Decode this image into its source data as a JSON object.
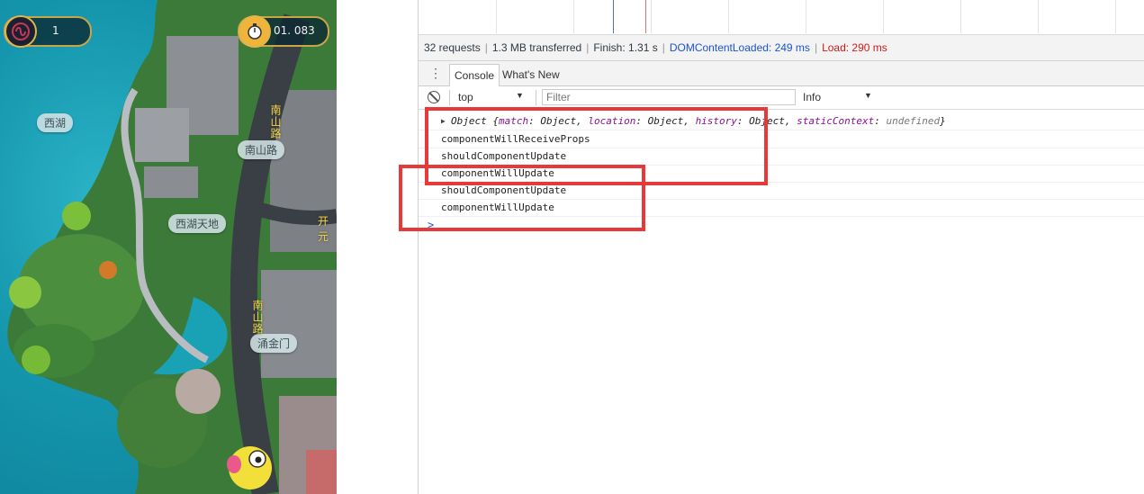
{
  "game": {
    "score": "1",
    "timer": "01. 083",
    "labels": {
      "xihu": "西湖",
      "nanshanlu": "南山路",
      "xihutiandi": "西湖天地",
      "yongjinmen": "涌金门"
    },
    "road_labels": {
      "road_top": "南山路",
      "road_bottom": "南山路",
      "road_right": "开元"
    },
    "colors": {
      "water": "#1596ad",
      "hud_border": "#c9a548",
      "road_text": "#f4d64a"
    }
  },
  "devtools": {
    "summary": {
      "requests": "32 requests",
      "transferred": "1.3 MB transferred",
      "finish": "Finish: 1.31 s",
      "dcl": "DOMContentLoaded: 249 ms",
      "load": "Load: 290 ms"
    },
    "tabs": [
      "Console",
      "What's New"
    ],
    "toolbar": {
      "context": "top",
      "filter_placeholder": "Filter",
      "level": "Info"
    },
    "messages": {
      "object_line": {
        "prefix": "Object {",
        "k1": "match",
        "v1": ": Object, ",
        "k2": "location",
        "v2": ": Object, ",
        "k3": "history",
        "v3": ": Object, ",
        "k4": "staticContext",
        "v4": ": ",
        "v4_value": "undefined",
        "suffix": "}"
      },
      "lines": [
        "componentWillReceiveProps",
        "shouldComponentUpdate",
        "componentWillUpdate",
        "shouldComponentUpdate",
        "componentWillUpdate"
      ],
      "prompt": ">"
    },
    "colors": {
      "dcl": "#1a54d4",
      "load": "#d11a1a",
      "annotation": "#e63a3a"
    }
  }
}
